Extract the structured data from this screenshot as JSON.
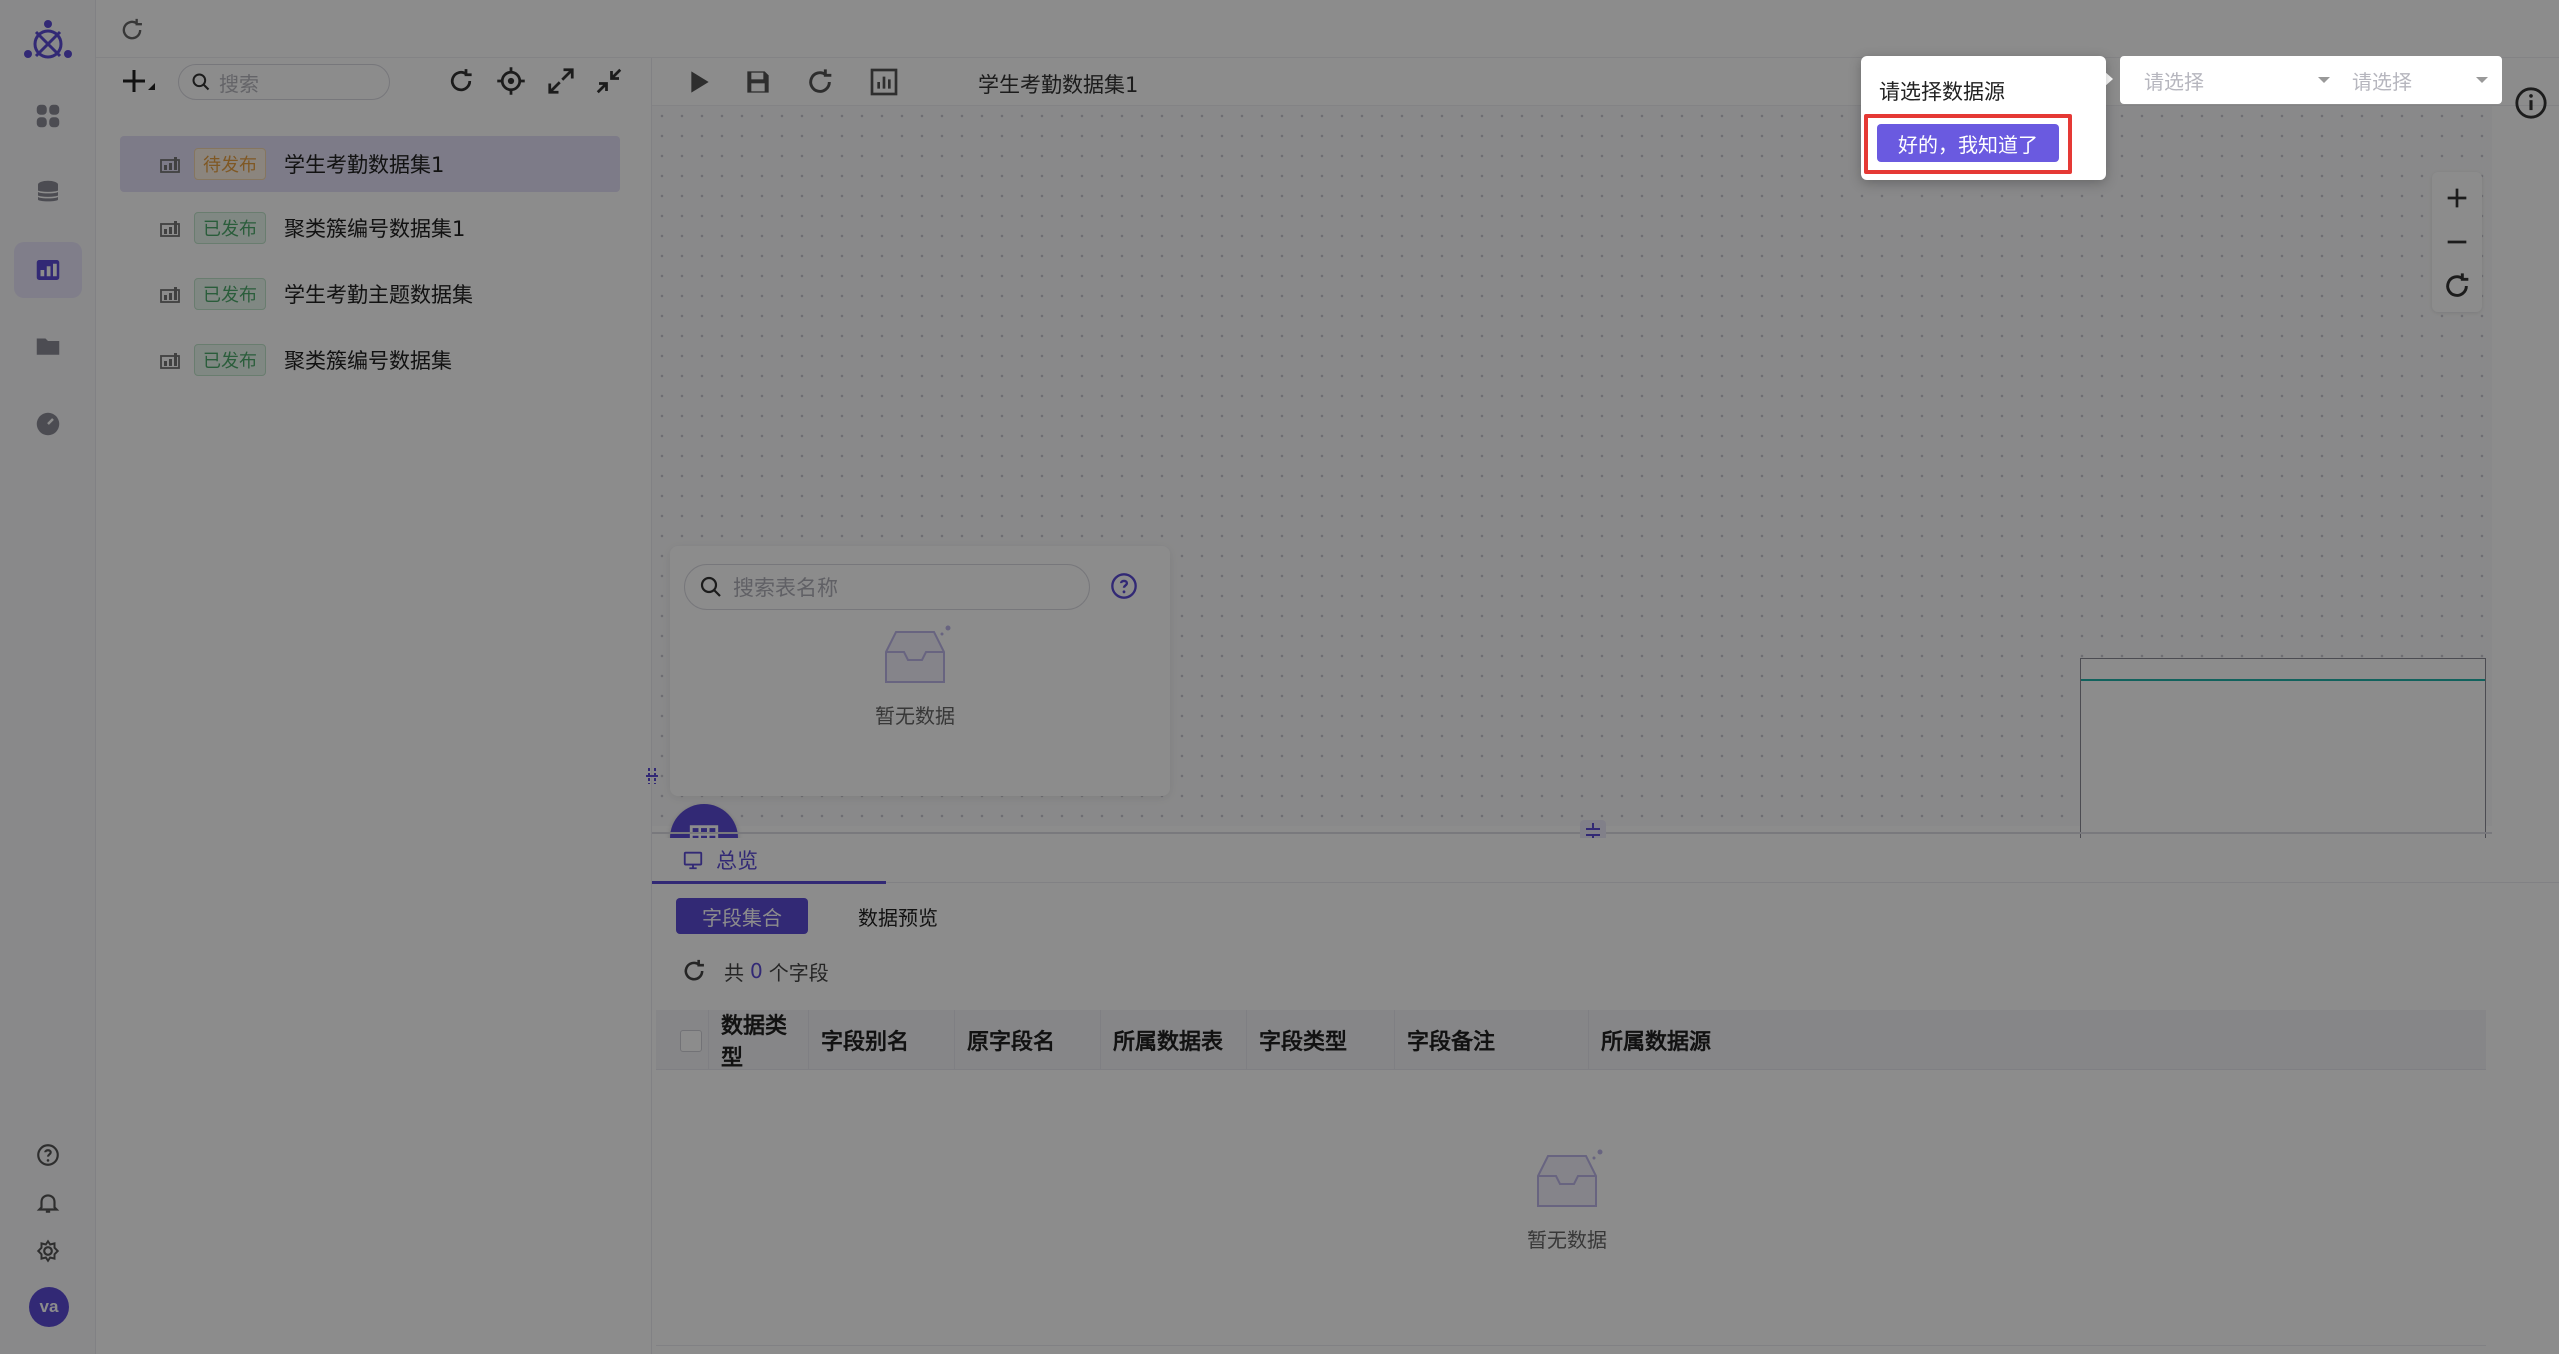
{
  "tree": {
    "search_placeholder": "搜索",
    "items": [
      {
        "status": "待发布",
        "name": "学生考勤数据集1"
      },
      {
        "status": "已发布",
        "name": "聚类簇编号数据集1"
      },
      {
        "status": "已发布",
        "name": "学生考勤主题数据集"
      },
      {
        "status": "已发布",
        "name": "聚类簇编号数据集"
      }
    ]
  },
  "editor": {
    "dataset_title": "学生考勤数据集1",
    "table_search_placeholder": "搜索表名称",
    "tables_empty": "暂无数据"
  },
  "datasource": {
    "select1_placeholder": "请选择",
    "select2_placeholder": "请选择"
  },
  "tour": {
    "title": "请选择数据源",
    "confirm_label": "好的，我知道了"
  },
  "bottom": {
    "tab_label": "总览",
    "seg_fields": "字段集合",
    "seg_preview": "数据预览",
    "count_prefix": "共",
    "count_value": "0",
    "count_suffix": "个字段",
    "columns": [
      "数据类型",
      "字段别名",
      "原字段名",
      "所属数据表",
      "字段类型",
      "字段备注",
      "所属数据源"
    ],
    "empty_text": "暂无数据"
  },
  "user": {
    "avatar_initials": "va"
  },
  "colors": {
    "accent": "#5b4bd6",
    "pending": "#e8a043",
    "published": "#4eaa6c",
    "highlight": "#e53935"
  }
}
